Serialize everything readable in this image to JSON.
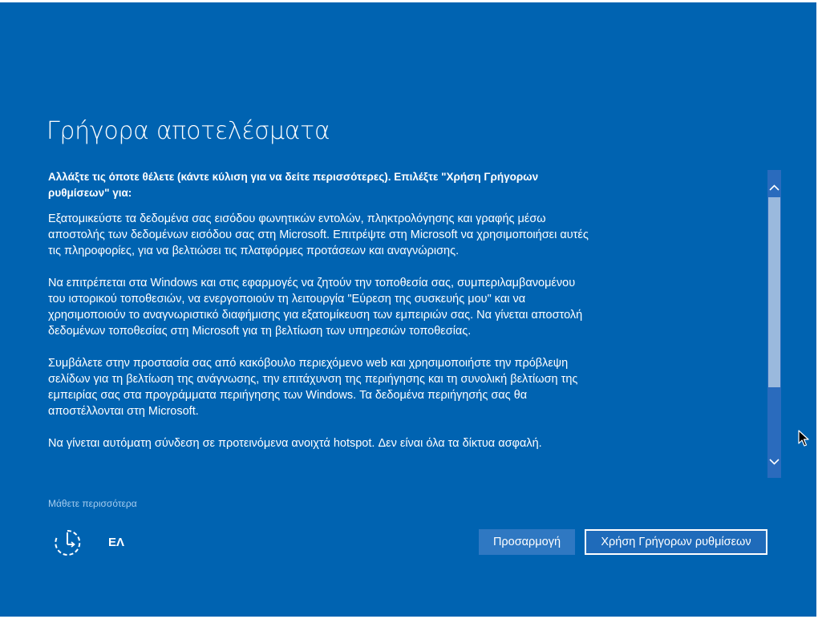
{
  "title": "Γρήγορα αποτελέσματα",
  "intro": "Αλλάξτε τις όποτε θέλετε (κάντε κύλιση για να δείτε περισσότερες). Επιλέξτε \"Χρήση Γρήγορων ρυθμίσεων\" για:",
  "paragraphs": [
    "Εξατομικεύστε τα δεδομένα σας εισόδου φωνητικών εντολών, πληκτρολόγησης και γραφής μέσω αποστολής των δεδομένων εισόδου σας στη Microsoft. Επιτρέψτε στη Microsoft να χρησιμοποιήσει αυτές τις πληροφορίες, για να βελτιώσει τις πλατφόρμες προτάσεων και αναγνώρισης.",
    "Να επιτρέπεται στα Windows και στις εφαρμογές να ζητούν την τοποθεσία σας, συμπεριλαμβανομένου του ιστορικού τοποθεσιών, να ενεργοποιούν τη λειτουργία \"Εύρεση της συσκευής μου\" και να χρησιμοποιούν το αναγνωριστικό διαφήμισης για εξατομίκευση των εμπειριών σας. Να γίνεται αποστολή δεδομένων τοποθεσίας στη Microsoft για τη βελτίωση των υπηρεσιών τοποθεσίας.",
    "Συμβάλετε στην προστασία σας από κακόβουλο περιεχόμενο web και χρησιμοποιήστε την πρόβλεψη σελίδων για τη βελτίωση της ανάγνωσης, την επιτάχυνση της περιήγησης και τη συνολική βελτίωση της εμπειρίας σας στα προγράμματα περιήγησης των Windows. Τα δεδομένα περιήγησής σας θα αποστέλλονται στη Microsoft.",
    "Να γίνεται αυτόματη σύνδεση σε προτεινόμενα ανοιχτά hotspot. Δεν είναι όλα τα δίκτυα ασφαλή."
  ],
  "learn_more": "Μάθετε περισσότερα",
  "language": "ΕΛ",
  "buttons": {
    "customize": "Προσαρμογή",
    "express": "Χρήση Γρήγορων ρυθμίσεων"
  },
  "scrollbar": {
    "up_icon": "chevron-up-icon",
    "down_icon": "chevron-down-icon"
  },
  "icons": {
    "ease_of_access": "ease-of-access-icon",
    "cursor": "mouse-pointer-icon"
  },
  "colors": {
    "background": "#0063b1",
    "button_customize": "#2f78c2",
    "button_express": "#1f6bba",
    "link": "#a7cdef",
    "scroll_thumb": "#9ab9dd"
  }
}
